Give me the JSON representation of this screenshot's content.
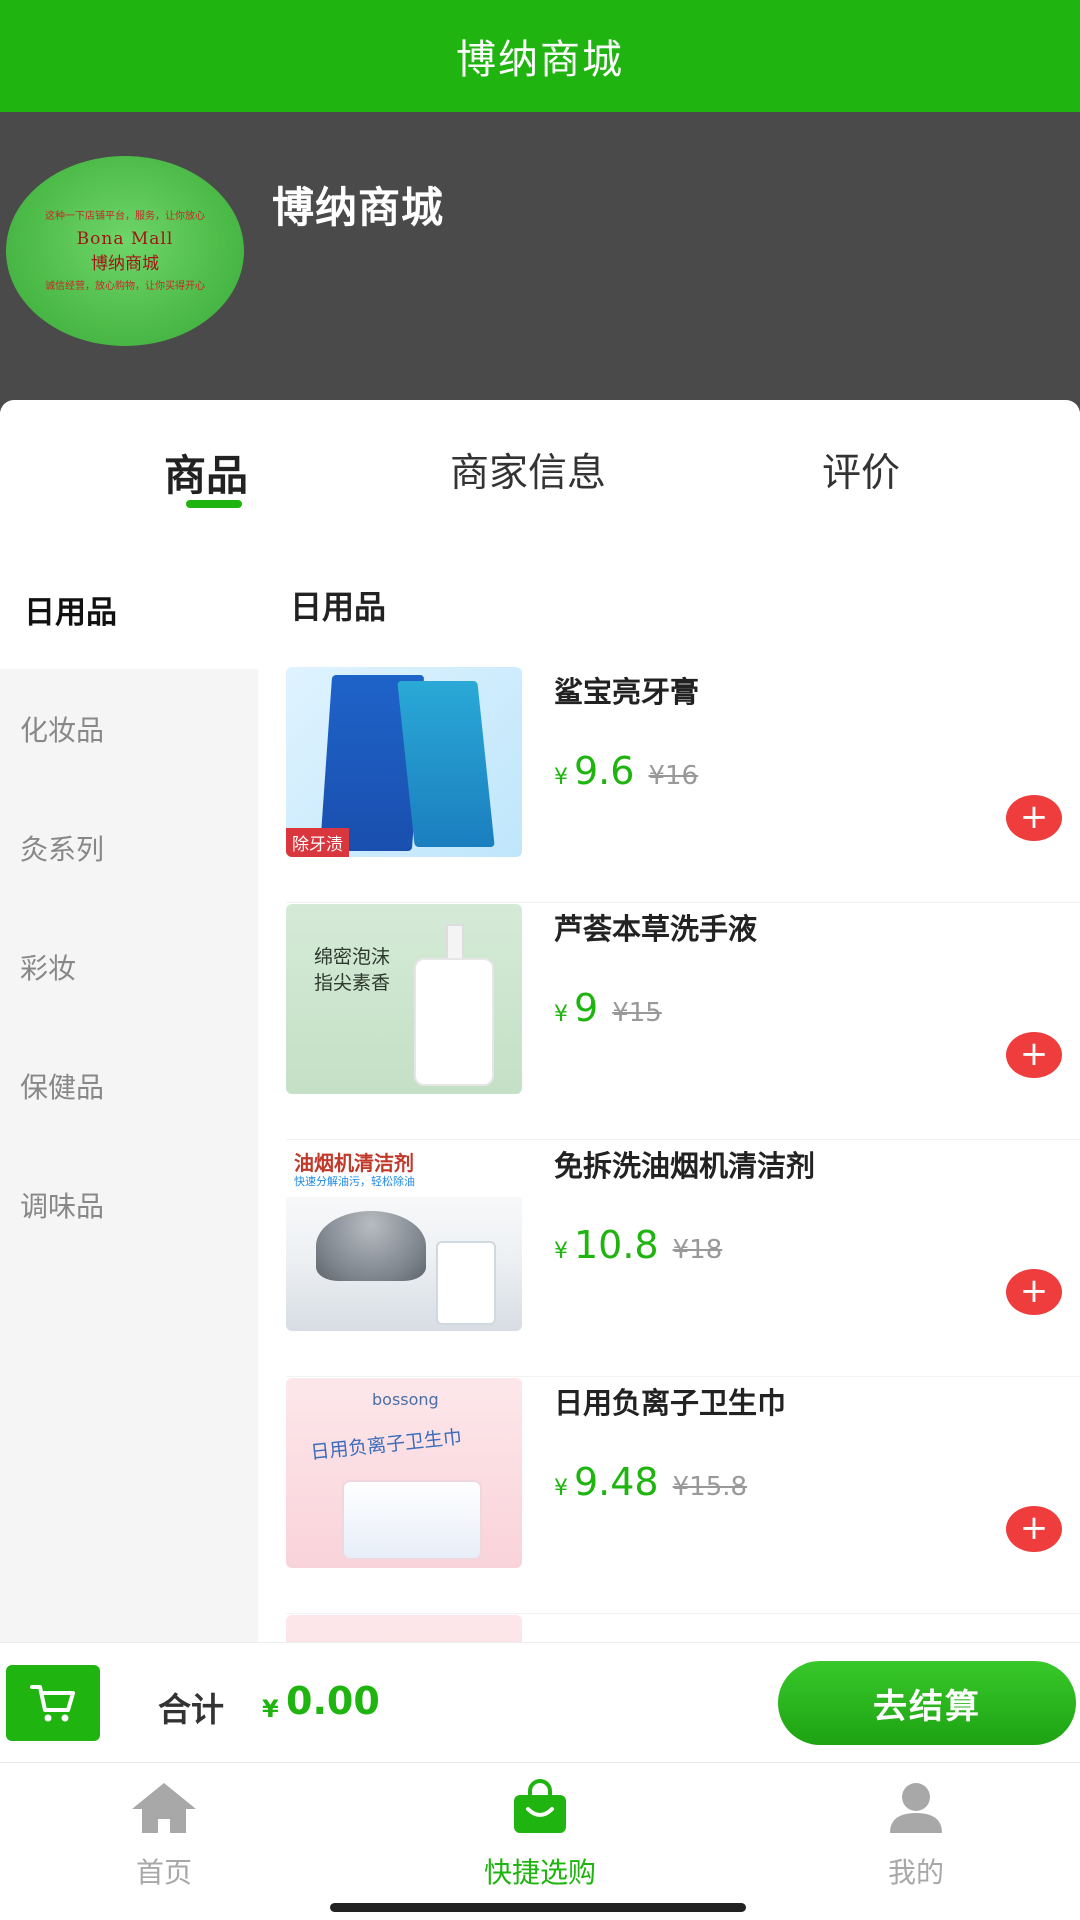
{
  "app": {
    "title": "博纳商城"
  },
  "store": {
    "name": "博纳商城",
    "logo": {
      "line_top": "这种一下店铺平台，服务，让你放心",
      "text_en": "Bona Mall",
      "text_cn": "博纳商城",
      "line_bottom": "诚信经营，放心购物，让你买得开心"
    }
  },
  "tabs": [
    {
      "label": "商品",
      "active": true
    },
    {
      "label": "商家信息",
      "active": false
    },
    {
      "label": "评价",
      "active": false
    }
  ],
  "categories": [
    {
      "label": "日用品",
      "active": true
    },
    {
      "label": "化妆品",
      "active": false
    },
    {
      "label": "灸系列",
      "active": false
    },
    {
      "label": "彩妆",
      "active": false
    },
    {
      "label": "保健品",
      "active": false
    },
    {
      "label": "调味品",
      "active": false
    }
  ],
  "section_title": "日用品",
  "currency_symbol": "¥",
  "products": [
    {
      "name": "鲨宝亮牙膏",
      "price": "9.6",
      "original": "¥16",
      "image_tag": "除牙渍"
    },
    {
      "name": "芦荟本草洗手液",
      "price": "9",
      "original": "¥15",
      "image_text_1": "绵密泡沫",
      "image_text_2": "指尖素香"
    },
    {
      "name": "免拆洗油烟机清洁剂",
      "price": "10.8",
      "original": "¥18",
      "image_title": "油烟机清洁剂",
      "image_sub": "快速分解油污，轻松除油"
    },
    {
      "name": "日用负离子卫生巾",
      "price": "9.48",
      "original": "¥15.8",
      "image_brand": "bossong",
      "image_script": "日用负离子卫生巾"
    }
  ],
  "checkout": {
    "total_label": "合计",
    "total_value": "0.00",
    "pay_label": "去结算"
  },
  "bottom_nav": [
    {
      "label": "首页",
      "icon": "home-icon",
      "active": false
    },
    {
      "label": "快捷选购",
      "icon": "shopping-bag-icon",
      "active": true
    },
    {
      "label": "我的",
      "icon": "user-icon",
      "active": false
    }
  ],
  "colors": {
    "brand_green": "#1fb40f",
    "add_red": "#ef3c3c",
    "banner_gray": "#4a4a4a"
  }
}
